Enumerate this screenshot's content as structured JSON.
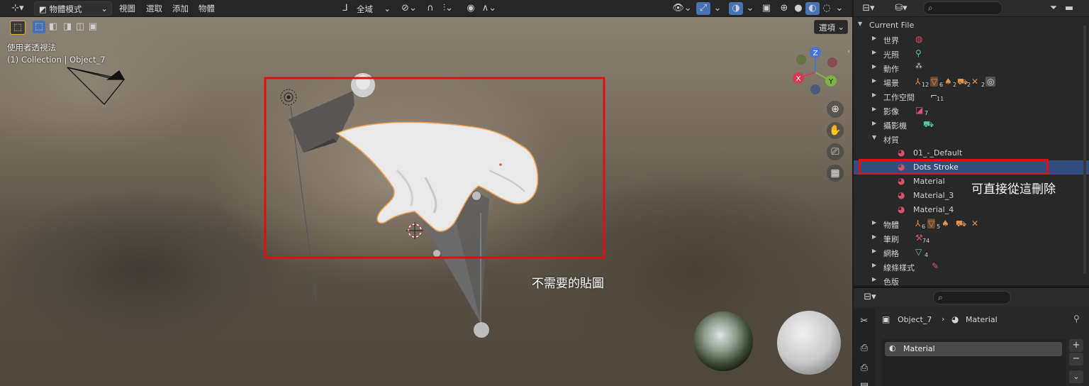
{
  "viewport": {
    "header": {
      "mode": "物體模式",
      "menus": [
        "視圖",
        "選取",
        "添加",
        "物體"
      ],
      "transform_orientation": "全域"
    },
    "options_label": "選項",
    "overlay": {
      "view_name": "使用者透視法",
      "collection_info": "(1) Collection | Object_7"
    },
    "gizmo": {
      "x": "X",
      "y": "Y",
      "z": "Z"
    },
    "annotation": {
      "text": "不需要的貼圖",
      "color": "#e01010"
    }
  },
  "outliner": {
    "root": "Current File",
    "items": [
      {
        "label": "世界",
        "icon": "world-icon",
        "count": ""
      },
      {
        "label": "光照",
        "icon": "light-icon",
        "count": ""
      },
      {
        "label": "動作",
        "icon": "action-icon",
        "count": ""
      },
      {
        "label": "場景",
        "icon": "scene-icon",
        "count": "12"
      },
      {
        "label": "工作空間",
        "icon": "workspace-icon",
        "count": "11"
      },
      {
        "label": "影像",
        "icon": "image-icon",
        "count": "7"
      },
      {
        "label": "攝影機",
        "icon": "camera-icon",
        "count": ""
      },
      {
        "label": "材質",
        "icon": "material-icon",
        "count": ""
      }
    ],
    "materials": [
      "01_-_Default",
      "Dots Stroke",
      "Material",
      "Material_3",
      "Material_4"
    ],
    "selected_material": "Dots Stroke",
    "items_after": [
      {
        "label": "物體",
        "count": "6"
      },
      {
        "label": "筆刷",
        "count": "74"
      },
      {
        "label": "網格",
        "count": "4"
      },
      {
        "label": "線條樣式",
        "count": ""
      },
      {
        "label": "色版",
        "count": ""
      }
    ],
    "scene_counts": [
      "12",
      "6",
      "2",
      "2",
      "2"
    ],
    "object_counts": [
      "6",
      "5"
    ],
    "annotation": {
      "text": "可直接從這刪除"
    }
  },
  "properties": {
    "breadcrumb_object": "Object_7",
    "breadcrumb_material": "Material",
    "slot_label": "Material",
    "add_label": "+",
    "remove_label": "−"
  }
}
